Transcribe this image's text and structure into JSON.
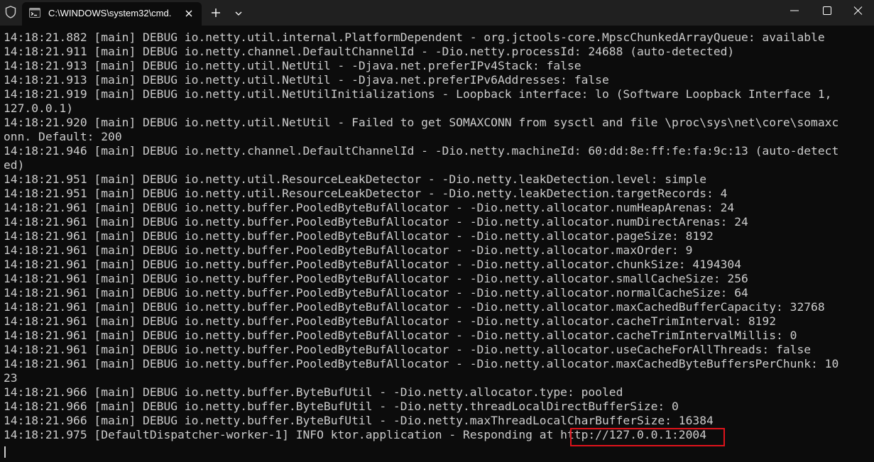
{
  "window": {
    "tab_title": "C:\\WINDOWS\\system32\\cmd.",
    "icons": [
      "shield-icon",
      "cmd-icon",
      "close-icon",
      "plus-icon",
      "chevron-down-icon",
      "minimize-icon",
      "maximize-icon",
      "close-icon"
    ]
  },
  "console": {
    "lines": [
      "14:18:21.882 [main] DEBUG io.netty.util.internal.PlatformDependent - org.jctools-core.MpscChunkedArrayQueue: available",
      "14:18:21.911 [main] DEBUG io.netty.channel.DefaultChannelId - -Dio.netty.processId: 24688 (auto-detected)",
      "14:18:21.913 [main] DEBUG io.netty.util.NetUtil - -Djava.net.preferIPv4Stack: false",
      "14:18:21.913 [main] DEBUG io.netty.util.NetUtil - -Djava.net.preferIPv6Addresses: false",
      "14:18:21.919 [main] DEBUG io.netty.util.NetUtilInitializations - Loopback interface: lo (Software Loopback Interface 1,",
      "127.0.0.1)",
      "14:18:21.920 [main] DEBUG io.netty.util.NetUtil - Failed to get SOMAXCONN from sysctl and file \\proc\\sys\\net\\core\\somaxc",
      "onn. Default: 200",
      "14:18:21.946 [main] DEBUG io.netty.channel.DefaultChannelId - -Dio.netty.machineId: 60:dd:8e:ff:fe:fa:9c:13 (auto-detect",
      "ed)",
      "14:18:21.951 [main] DEBUG io.netty.util.ResourceLeakDetector - -Dio.netty.leakDetection.level: simple",
      "14:18:21.951 [main] DEBUG io.netty.util.ResourceLeakDetector - -Dio.netty.leakDetection.targetRecords: 4",
      "14:18:21.961 [main] DEBUG io.netty.buffer.PooledByteBufAllocator - -Dio.netty.allocator.numHeapArenas: 24",
      "14:18:21.961 [main] DEBUG io.netty.buffer.PooledByteBufAllocator - -Dio.netty.allocator.numDirectArenas: 24",
      "14:18:21.961 [main] DEBUG io.netty.buffer.PooledByteBufAllocator - -Dio.netty.allocator.pageSize: 8192",
      "14:18:21.961 [main] DEBUG io.netty.buffer.PooledByteBufAllocator - -Dio.netty.allocator.maxOrder: 9",
      "14:18:21.961 [main] DEBUG io.netty.buffer.PooledByteBufAllocator - -Dio.netty.allocator.chunkSize: 4194304",
      "14:18:21.961 [main] DEBUG io.netty.buffer.PooledByteBufAllocator - -Dio.netty.allocator.smallCacheSize: 256",
      "14:18:21.961 [main] DEBUG io.netty.buffer.PooledByteBufAllocator - -Dio.netty.allocator.normalCacheSize: 64",
      "14:18:21.961 [main] DEBUG io.netty.buffer.PooledByteBufAllocator - -Dio.netty.allocator.maxCachedBufferCapacity: 32768",
      "14:18:21.961 [main] DEBUG io.netty.buffer.PooledByteBufAllocator - -Dio.netty.allocator.cacheTrimInterval: 8192",
      "14:18:21.961 [main] DEBUG io.netty.buffer.PooledByteBufAllocator - -Dio.netty.allocator.cacheTrimIntervalMillis: 0",
      "14:18:21.961 [main] DEBUG io.netty.buffer.PooledByteBufAllocator - -Dio.netty.allocator.useCacheForAllThreads: false",
      "14:18:21.961 [main] DEBUG io.netty.buffer.PooledByteBufAllocator - -Dio.netty.allocator.maxCachedByteBuffersPerChunk: 10",
      "23",
      "14:18:21.966 [main] DEBUG io.netty.buffer.ByteBufUtil - -Dio.netty.allocator.type: pooled",
      "14:18:21.966 [main] DEBUG io.netty.buffer.ByteBufUtil - -Dio.netty.threadLocalDirectBufferSize: 0",
      "14:18:21.966 [main] DEBUG io.netty.buffer.ByteBufUtil - -Dio.netty.maxThreadLocalCharBufferSize: 16384",
      "14:18:21.975 [DefaultDispatcher-worker-1] INFO ktor.application - Responding at http://127.0.0.1:2004"
    ],
    "highlight": {
      "text": "http://127.0.0.1:2004",
      "color": "#e0131b"
    }
  }
}
